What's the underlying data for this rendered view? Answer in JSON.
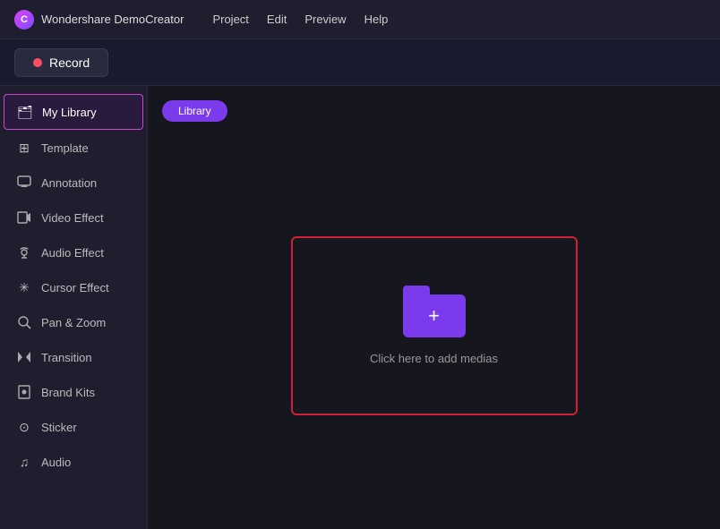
{
  "titlebar": {
    "app_name": "Wondershare DemoCreator",
    "logo_text": "C",
    "menu_items": [
      "Project",
      "Edit",
      "Preview",
      "Help"
    ]
  },
  "toolbar": {
    "record_label": "Record"
  },
  "sidebar": {
    "items": [
      {
        "id": "my-library",
        "label": "My Library",
        "icon": "🗂",
        "active": true
      },
      {
        "id": "template",
        "label": "Template",
        "icon": "⊞"
      },
      {
        "id": "annotation",
        "label": "Annotation",
        "icon": "💬"
      },
      {
        "id": "video-effect",
        "label": "Video Effect",
        "icon": "🎬"
      },
      {
        "id": "audio-effect",
        "label": "Audio Effect",
        "icon": "🎵"
      },
      {
        "id": "cursor-effect",
        "label": "Cursor Effect",
        "icon": "✳"
      },
      {
        "id": "pan-zoom",
        "label": "Pan & Zoom",
        "icon": "🔎"
      },
      {
        "id": "transition",
        "label": "Transition",
        "icon": "⊳⊲"
      },
      {
        "id": "brand-kits",
        "label": "Brand Kits",
        "icon": "🔖"
      },
      {
        "id": "sticker",
        "label": "Sticker",
        "icon": "⊙"
      },
      {
        "id": "audio",
        "label": "Audio",
        "icon": "♫"
      }
    ]
  },
  "content": {
    "tab_label": "Library",
    "add_media_text": "Click here to add medias"
  }
}
